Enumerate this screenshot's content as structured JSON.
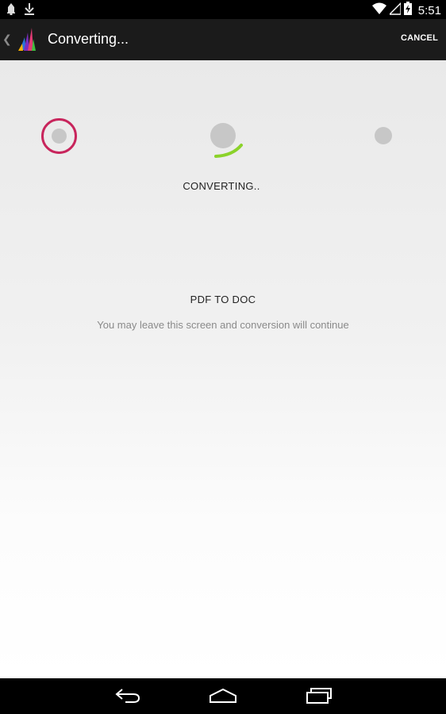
{
  "status_bar": {
    "time": "5:51",
    "icons": [
      "notification-icon",
      "download-icon",
      "wifi-icon",
      "signal-icon",
      "battery-charging-icon"
    ]
  },
  "action_bar": {
    "title": "Converting...",
    "cancel_label": "CANCEL"
  },
  "conversion": {
    "status": "CONVERTING..",
    "label": "PDF TO DOC",
    "note": "You may leave this screen and conversion will continue"
  },
  "colors": {
    "ring": "#c8255c",
    "spinner": "#8bd22a",
    "dot": "#c7c7c7"
  },
  "navigation": {
    "buttons": [
      "back-icon",
      "home-icon",
      "recent-apps-icon"
    ]
  }
}
